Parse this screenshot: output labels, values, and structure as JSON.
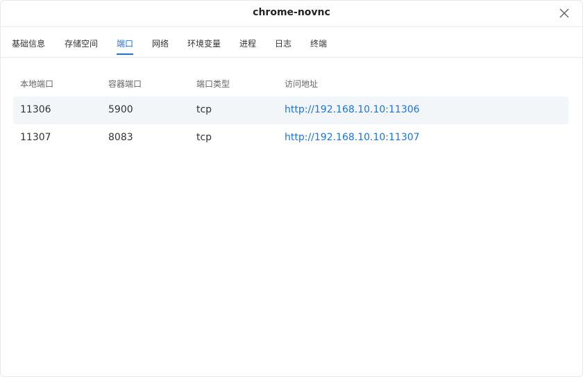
{
  "dialog": {
    "title": "chrome-novnc"
  },
  "tabs": [
    {
      "label": "基础信息"
    },
    {
      "label": "存储空间"
    },
    {
      "label": "端口"
    },
    {
      "label": "网络"
    },
    {
      "label": "环境变量"
    },
    {
      "label": "进程"
    },
    {
      "label": "日志"
    },
    {
      "label": "终端"
    }
  ],
  "active_tab": "端口",
  "ports": {
    "headers": [
      "本地端口",
      "容器端口",
      "端口类型",
      "访问地址"
    ],
    "rows": [
      {
        "local": "11306",
        "container": "5900",
        "type": "tcp",
        "url": "http://192.168.10.10:11306"
      },
      {
        "local": "11307",
        "container": "8083",
        "type": "tcp",
        "url": "http://192.168.10.10:11307"
      }
    ]
  },
  "colors": {
    "accent": "#1a73e8",
    "row_highlight": "#f3f6f9",
    "border": "#e8eaed"
  }
}
